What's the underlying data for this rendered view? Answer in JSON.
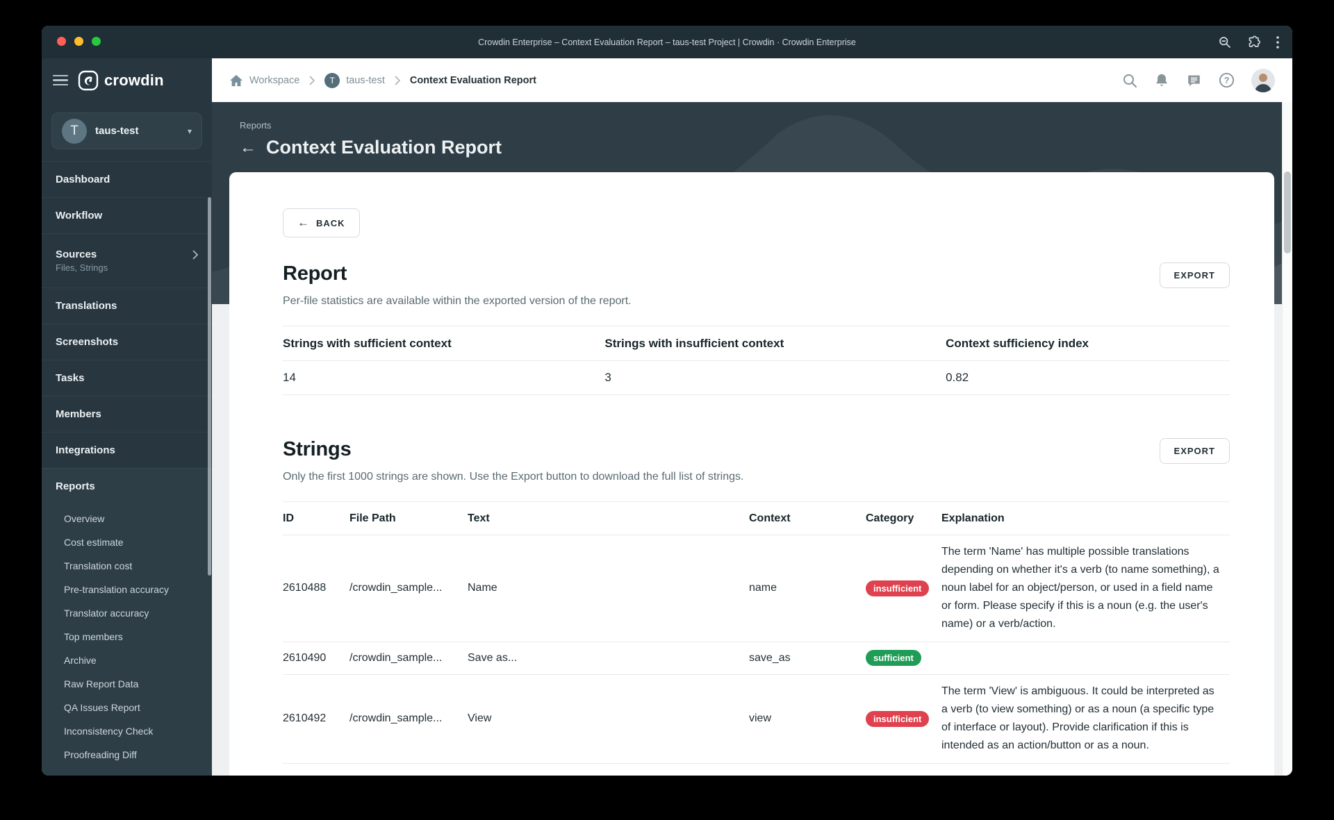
{
  "titlebar": {
    "title": "Crowdin Enterprise – Context Evaluation Report – taus-test Project | Crowdin · Crowdin Enterprise"
  },
  "brand": {
    "name": "crowdin"
  },
  "breadcrumb": {
    "workspace": "Workspace",
    "project": "taus-test",
    "project_avatar": "T",
    "current": "Context Evaluation Report"
  },
  "sidebar": {
    "project": {
      "name": "taus-test",
      "avatar": "T"
    },
    "items": [
      {
        "label": "Dashboard"
      },
      {
        "label": "Workflow"
      },
      {
        "label": "Sources",
        "subtitle": "Files, Strings"
      },
      {
        "label": "Translations"
      },
      {
        "label": "Screenshots"
      },
      {
        "label": "Tasks"
      },
      {
        "label": "Members"
      },
      {
        "label": "Integrations"
      },
      {
        "label": "Reports"
      }
    ],
    "report_items": [
      {
        "label": "Overview"
      },
      {
        "label": "Cost estimate"
      },
      {
        "label": "Translation cost"
      },
      {
        "label": "Pre-translation accuracy"
      },
      {
        "label": "Translator accuracy"
      },
      {
        "label": "Top members"
      },
      {
        "label": "Archive"
      },
      {
        "label": "Raw Report Data"
      },
      {
        "label": "QA Issues Report"
      },
      {
        "label": "Inconsistency Check"
      },
      {
        "label": "Proofreading Diff"
      }
    ]
  },
  "banner": {
    "eyebrow": "Reports",
    "title": "Context Evaluation Report"
  },
  "report_section": {
    "back_label": "BACK",
    "title": "Report",
    "subtitle": "Per-file statistics are available within the exported version of the report.",
    "export_label": "EXPORT",
    "stats": {
      "headers": [
        "Strings with sufficient context",
        "Strings with insufficient context",
        "Context sufficiency index"
      ],
      "values": [
        "14",
        "3",
        "0.82"
      ]
    }
  },
  "strings_section": {
    "title": "Strings",
    "subtitle": "Only the first 1000 strings are shown. Use the Export button to download the full list of strings.",
    "export_label": "EXPORT",
    "table": {
      "headers": [
        "ID",
        "File Path",
        "Text",
        "Context",
        "Category",
        "Explanation"
      ],
      "rows": [
        {
          "id": "2610488",
          "file_path": "/crowdin_sample...",
          "text": "Name",
          "context": "name",
          "category": "insufficient",
          "explanation": "The term 'Name' has multiple possible translations depending on whether it's a verb (to name something), a noun label for an object/person, or used in a field name or form. Please specify if this is a noun (e.g. the user's name) or a verb/action."
        },
        {
          "id": "2610490",
          "file_path": "/crowdin_sample...",
          "text": "Save as...",
          "context": "save_as",
          "category": "sufficient",
          "explanation": ""
        },
        {
          "id": "2610492",
          "file_path": "/crowdin_sample...",
          "text": "View",
          "context": "view",
          "category": "insufficient",
          "explanation": "The term 'View' is ambiguous. It could be interpreted as a verb (to view something) or as a noun (a specific type of interface or layout). Provide clarification if this is intended as an action/button or as a noun."
        }
      ]
    }
  },
  "colors": {
    "badge_insufficient": "#e0414e",
    "badge_sufficient": "#1f9d57",
    "titlebar_bg": "#202e36",
    "sidebar_bg": "#27363f",
    "banner_bg": "#2e3d46"
  }
}
